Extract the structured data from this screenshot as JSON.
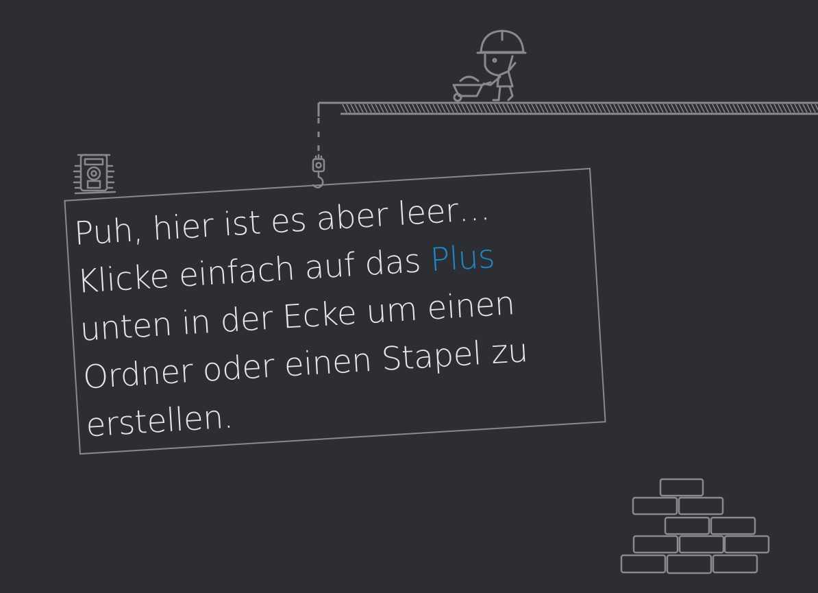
{
  "empty_state": {
    "line1": "Puh, hier ist es aber leer…",
    "line2_before": "Klicke einfach auf das ",
    "line2_link": "Plus",
    "line3": "unten in der Ecke um einen",
    "line4": "Ordner oder einen Stapel zu",
    "line5": "erstellen."
  },
  "colors": {
    "background": "#2d2e33",
    "line_art": "#8a8a8a",
    "text": "#e6e6e6",
    "accent": "#1e88c9"
  },
  "icons": [
    "construction-worker-icon",
    "wheelbarrow-icon",
    "crane-hook-icon",
    "robot-icon",
    "brick-pile-icon"
  ]
}
